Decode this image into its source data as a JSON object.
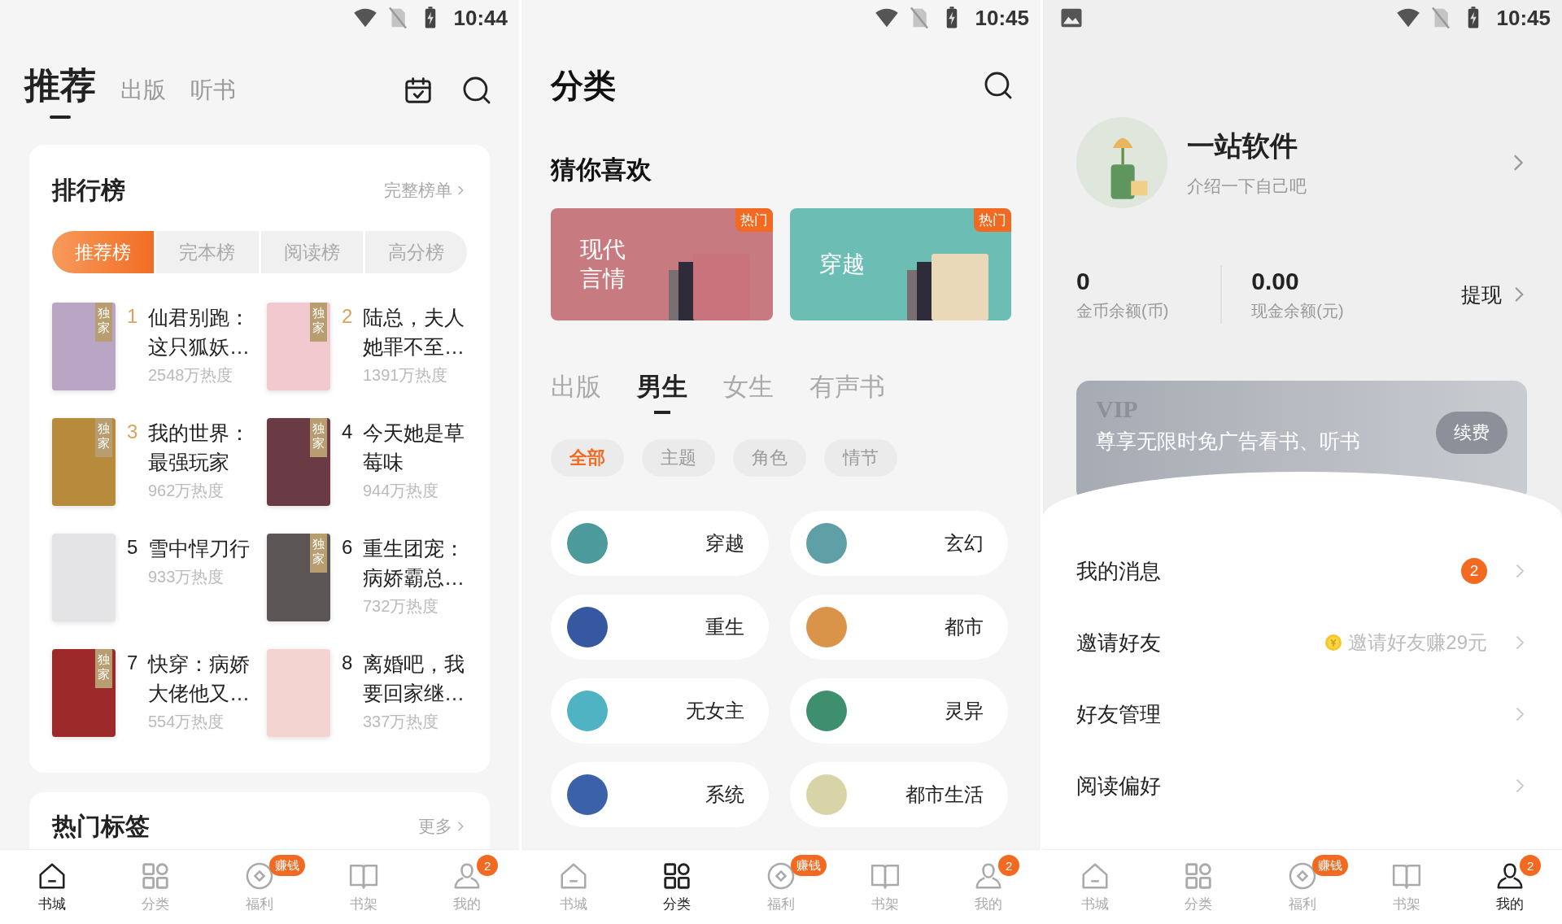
{
  "recommend_screen": {
    "status_bar": {
      "time": "10:44"
    },
    "top_tabs": [
      {
        "label": "推荐",
        "selected": true
      },
      {
        "label": "出版",
        "selected": false
      },
      {
        "label": "听书",
        "selected": false
      }
    ],
    "ranking": {
      "title": "排行榜",
      "link": "完整榜单",
      "tabs": [
        {
          "label": "推荐榜",
          "selected": true
        },
        {
          "label": "完本榜",
          "selected": false
        },
        {
          "label": "阅读榜",
          "selected": false
        },
        {
          "label": "高分榜",
          "selected": false
        }
      ],
      "books": [
        {
          "rank": "1",
          "color": "#d9a35e",
          "title": "仙君别跑：这只狐妖…",
          "heat": "2548万热度",
          "exclusive": "独家"
        },
        {
          "rank": "2",
          "color": "#d9a35e",
          "title": "陆总，夫人她罪不至…",
          "heat": "1391万热度",
          "exclusive": "独家"
        },
        {
          "rank": "3",
          "color": "#d9a35e",
          "title": "我的世界：最强玩家",
          "heat": "962万热度",
          "exclusive": "独家"
        },
        {
          "rank": "4",
          "color": "#222222",
          "title": "今天她是草莓味",
          "heat": "944万热度",
          "exclusive": "独家"
        },
        {
          "rank": "5",
          "color": "#222222",
          "title": "雪中悍刀行",
          "heat": "933万热度"
        },
        {
          "rank": "6",
          "color": "#222222",
          "title": "重生团宠：病娇霸总…",
          "heat": "732万热度",
          "exclusive": "独家"
        },
        {
          "rank": "7",
          "color": "#222222",
          "title": "快穿：病娇大佬他又…",
          "heat": "554万热度",
          "exclusive": "独家"
        },
        {
          "rank": "8",
          "color": "#222222",
          "title": "离婚吧，我要回家继…",
          "heat": "337万热度"
        }
      ]
    },
    "hot_tags": {
      "title": "热门标签",
      "link": "更多"
    },
    "bottom_nav": [
      {
        "label": "书城",
        "selected": true
      },
      {
        "label": "分类",
        "selected": false
      },
      {
        "label": "福利",
        "selected": false,
        "badge": "赚钱"
      },
      {
        "label": "书架",
        "selected": false
      },
      {
        "label": "我的",
        "selected": false,
        "badge": "2"
      }
    ]
  },
  "category_screen": {
    "status_bar": {
      "time": "10:45"
    },
    "title": "分类",
    "section_title": "猜你喜欢",
    "banners": [
      {
        "label": "现代言情",
        "tag": "热门",
        "color": "#c77b80"
      },
      {
        "label": "穿越",
        "tag": "热门",
        "color": "#6cbdb3"
      }
    ],
    "tabs": [
      {
        "label": "出版",
        "selected": false
      },
      {
        "label": "男生",
        "selected": true
      },
      {
        "label": "女生",
        "selected": false
      },
      {
        "label": "有声书",
        "selected": false
      }
    ],
    "filters": [
      {
        "label": "全部",
        "selected": true
      },
      {
        "label": "主题",
        "selected": false
      },
      {
        "label": "角色",
        "selected": false
      },
      {
        "label": "情节",
        "selected": false
      }
    ],
    "genres": [
      {
        "label": "穿越",
        "color": "#4d9a9c"
      },
      {
        "label": "玄幻",
        "color": "#5f9fa6"
      },
      {
        "label": "重生",
        "color": "#3558a0"
      },
      {
        "label": "都市",
        "color": "#d9944a"
      },
      {
        "label": "无女主",
        "color": "#4fb3c4"
      },
      {
        "label": "灵异",
        "color": "#3e8f6e"
      },
      {
        "label": "系统",
        "color": "#3b62a8"
      },
      {
        "label": "都市生活",
        "color": "#d8d4a8"
      }
    ],
    "bottom_nav": [
      {
        "label": "书城",
        "selected": false
      },
      {
        "label": "分类",
        "selected": true
      },
      {
        "label": "福利",
        "selected": false,
        "badge": "赚钱"
      },
      {
        "label": "书架",
        "selected": false
      },
      {
        "label": "我的",
        "selected": false,
        "badge": "2"
      }
    ]
  },
  "profile_screen": {
    "status_bar": {
      "time": "10:45"
    },
    "profile": {
      "name": "一站软件",
      "bio": "介绍一下自己吧"
    },
    "balances": [
      {
        "value": "0",
        "label": "金币余额(币)"
      },
      {
        "value": "0.00",
        "label": "现金余额(元)"
      }
    ],
    "withdraw": "提现",
    "vip": {
      "badge": "VIP",
      "text": "尊享无限时免广告看书、听书",
      "button": "续费"
    },
    "menu": [
      {
        "label": "我的消息",
        "badge": "2"
      },
      {
        "label": "邀请好友",
        "hint": "邀请好友赚29元"
      },
      {
        "label": "好友管理"
      },
      {
        "label": "阅读偏好"
      }
    ],
    "bottom_nav": [
      {
        "label": "书城",
        "selected": false
      },
      {
        "label": "分类",
        "selected": false
      },
      {
        "label": "福利",
        "selected": false,
        "badge": "赚钱"
      },
      {
        "label": "书架",
        "selected": false
      },
      {
        "label": "我的",
        "selected": true,
        "badge": "2"
      }
    ]
  }
}
